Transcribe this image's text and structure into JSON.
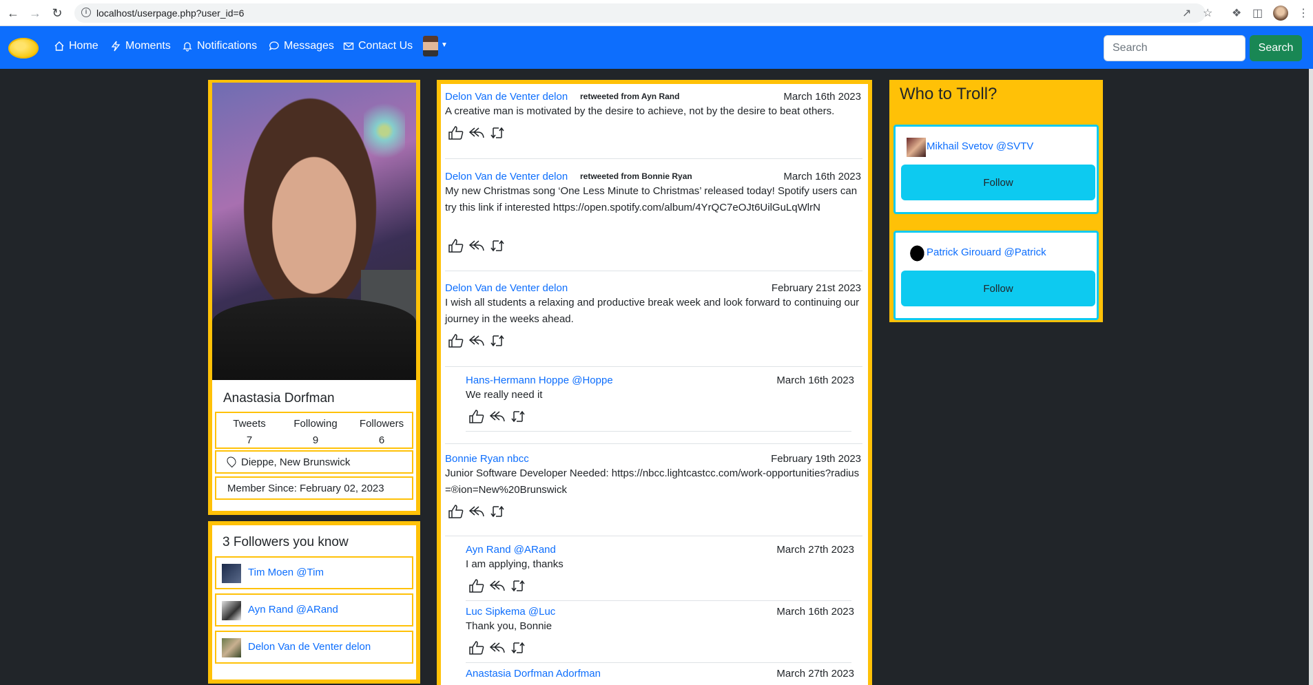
{
  "browser": {
    "url": "localhost/userpage.php?user_id=6"
  },
  "nav": {
    "items": [
      {
        "label": "Home",
        "icon": "home-icon"
      },
      {
        "label": "Moments",
        "icon": "lightning-icon"
      },
      {
        "label": "Notifications",
        "icon": "bell-icon"
      },
      {
        "label": "Messages",
        "icon": "chat-icon"
      },
      {
        "label": "Contact Us",
        "icon": "envelope-icon"
      }
    ],
    "search_placeholder": "Search",
    "search_button": "Search"
  },
  "profile": {
    "name": "Anastasia Dorfman",
    "stats": [
      {
        "label": "Tweets",
        "value": "7"
      },
      {
        "label": "Following",
        "value": "9"
      },
      {
        "label": "Followers",
        "value": "6"
      }
    ],
    "location": "Dieppe, New Brunswick",
    "member_since": "Member Since: February 02, 2023"
  },
  "followers_you_know": {
    "title": "3 Followers you know",
    "items": [
      {
        "name": "Tim Moen @Tim"
      },
      {
        "name": "Ayn Rand @ARand"
      },
      {
        "name": "Delon Van de Venter delon"
      }
    ]
  },
  "feed": {
    "posts": [
      {
        "author": "Delon Van de Venter delon",
        "retweet": "retweeted from Ayn Rand",
        "date": "March 16th 2023",
        "body": "A creative man is motivated by the desire to achieve, not by the desire to beat others."
      },
      {
        "author": "Delon Van de Venter delon",
        "retweet": "retweeted from Bonnie Ryan",
        "date": "March 16th 2023",
        "body": "My new Christmas song ‘One Less Minute to Christmas’ released today! Spotify users can try this link if interested https://open.spotify.com/album/4YrQC7eOJt6UilGuLqWlrN"
      },
      {
        "author": "Delon Van de Venter delon",
        "retweet": "",
        "date": "February 21st 2023",
        "body": "I wish all students a relaxing and productive break week and look forward to continuing our journey in the weeks ahead."
      },
      {
        "author": "Hans-Hermann Hoppe @Hoppe",
        "retweet": "",
        "date": "March 16th 2023",
        "body": "We really need it"
      },
      {
        "author": "Bonnie Ryan nbcc",
        "retweet": "",
        "date": "February 19th 2023",
        "body": "Junior Software Developer Needed: https://nbcc.lightcastcc.com/work-opportunities?radius=®ion=New%20Brunswick"
      },
      {
        "author": "Ayn Rand @ARand",
        "retweet": "",
        "date": "March 27th 2023",
        "body": "I am applying, thanks"
      },
      {
        "author": "Luc Sipkema @Luc",
        "retweet": "",
        "date": "March 16th 2023",
        "body": "Thank you, Bonnie"
      },
      {
        "author": "Anastasia Dorfman Adorfman",
        "retweet": "",
        "date": "March 27th 2023",
        "body": ""
      }
    ]
  },
  "who_to_troll": {
    "title": "Who to Troll?",
    "items": [
      {
        "name": "Mikhail Svetov @SVTV",
        "button": "Follow"
      },
      {
        "name": "Patrick Girouard @Patrick",
        "button": "Follow"
      }
    ]
  },
  "colors": {
    "navbar": "#0d6efd",
    "accent_yellow": "#ffc107",
    "follow_button": "#0dcaf0",
    "search_button": "#198754",
    "page_background": "#212529"
  }
}
